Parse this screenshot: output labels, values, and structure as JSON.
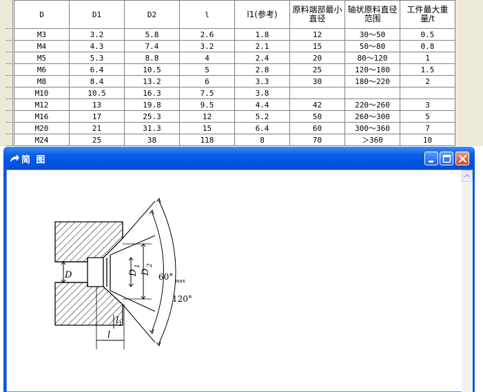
{
  "table": {
    "headers": [
      "D",
      "D1",
      "D2",
      "l",
      "l1(参考)",
      "原料端部最小直径",
      "轴状原料直径范围",
      "工件最大重量/t"
    ],
    "rows": [
      [
        "M3",
        "3.2",
        "5.8",
        "2.6",
        "1.8",
        "12",
        "30～50",
        "0.5"
      ],
      [
        "M4",
        "4.3",
        "7.4",
        "3.2",
        "2.1",
        "15",
        "50～80",
        "0.8"
      ],
      [
        "M5",
        "5.3",
        "8.8",
        "4",
        "2.4",
        "20",
        "80～120",
        "1"
      ],
      [
        "M6",
        "6.4",
        "10.5",
        "5",
        "2.8",
        "25",
        "120～180",
        "1.5"
      ],
      [
        "M8",
        "8.4",
        "13.2",
        "6",
        "3.3",
        "30",
        "180～220",
        "2"
      ],
      [
        "M10",
        "10.5",
        "16.3",
        "7.5",
        "3.8",
        "",
        "",
        ""
      ],
      [
        "M12",
        "13",
        "19.8",
        "9.5",
        "4.4",
        "42",
        "220～260",
        "3"
      ],
      [
        "M16",
        "17",
        "25.3",
        "12",
        "5.2",
        "50",
        "260～300",
        "5"
      ],
      [
        "M20",
        "21",
        "31.3",
        "15",
        "6.4",
        "60",
        "300～360",
        "7"
      ],
      [
        "M24",
        "25",
        "38",
        "118",
        "8",
        "70",
        "＞360",
        "10"
      ]
    ]
  },
  "window": {
    "title": "简 图",
    "icon": "arrow-curve-icon",
    "buttons": {
      "minimize": "minimize-icon",
      "maximize": "maximize-icon",
      "close": "close-icon"
    }
  },
  "diagram": {
    "labels": {
      "D": "D",
      "D1": "D",
      "D1_sub": "1",
      "D2": "D",
      "D2_sub": "2",
      "l": "l",
      "l1": "l",
      "l1_sub": "1",
      "angle60": "60°",
      "angle60_sub": "max",
      "angle120": "120°"
    }
  }
}
